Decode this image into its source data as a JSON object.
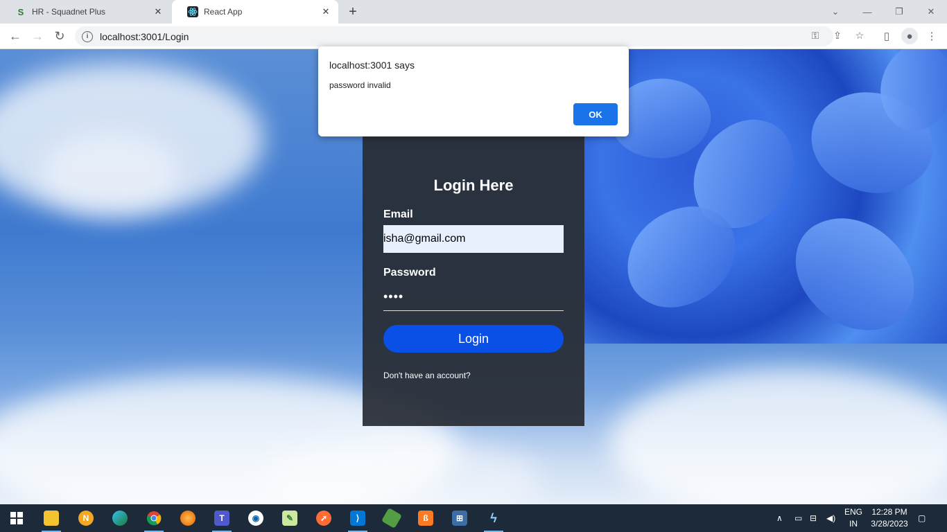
{
  "browser": {
    "tabs": [
      {
        "title": "HR - Squadnet Plus",
        "favicon": "S",
        "active": false
      },
      {
        "title": "React App",
        "favicon": "react-icon",
        "active": true
      }
    ],
    "new_tab": "+",
    "url": "localhost:3001/Login"
  },
  "login": {
    "title": "Login Here",
    "email_label": "Email",
    "email_value": "isha@gmail.com",
    "password_label": "Password",
    "password_value": "••••",
    "login_button": "Login",
    "signup_text": "Don't have an account?"
  },
  "dialog": {
    "title": "localhost:3001 says",
    "message": "password invalid",
    "ok_button": "OK"
  },
  "taskbar": {
    "lang_line1": "ENG",
    "lang_line2": "IN",
    "time": "12:28 PM",
    "date": "3/28/2023"
  },
  "colors": {
    "accent": "#1a73e8",
    "login_button": "#0a4fe6",
    "card_bg": "#282c34"
  }
}
